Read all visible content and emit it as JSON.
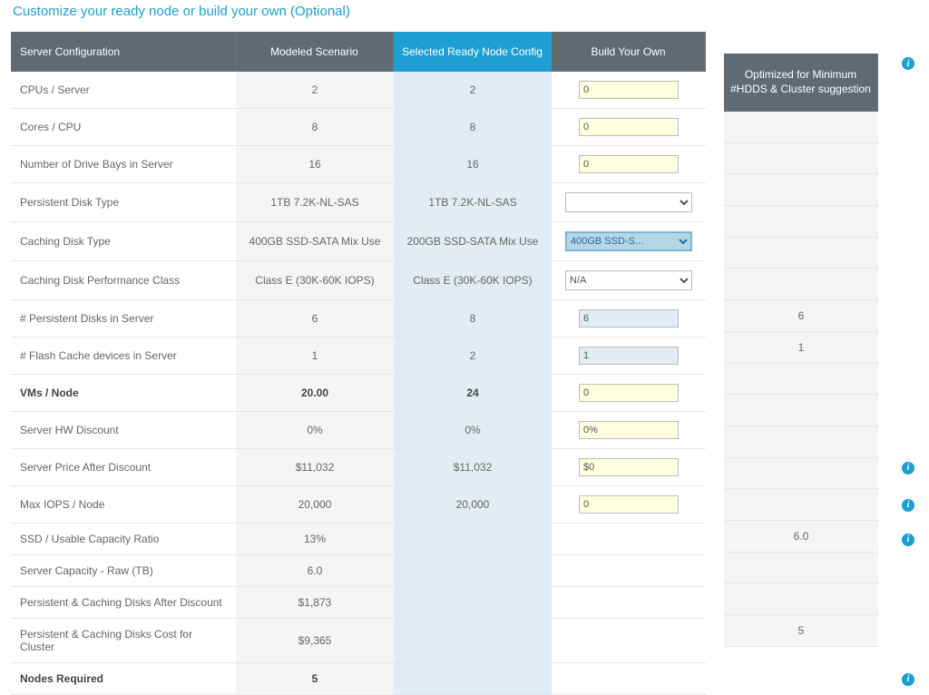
{
  "title": "Customize your ready node or build your own (Optional)",
  "headers": {
    "config": "Server Configuration",
    "modeled": "Modeled Scenario",
    "selected": "Selected Ready Node Config",
    "byo": "Build Your Own",
    "optimized": "Optimized for Minimum #HDDS & Cluster suggestion"
  },
  "rows": [
    {
      "label": "CPUs / Server",
      "model": "2",
      "sel": "2",
      "byo": "0",
      "byo_type": "text",
      "opt": ""
    },
    {
      "label": "Cores / CPU",
      "model": "8",
      "sel": "8",
      "byo": "0",
      "byo_type": "text",
      "opt": ""
    },
    {
      "label": "Number of Drive Bays in Server",
      "model": "16",
      "sel": "16",
      "byo": "0",
      "byo_type": "text",
      "opt": ""
    },
    {
      "label": "Persistent Disk Type",
      "model": "1TB 7.2K-NL-SAS",
      "sel": "1TB 7.2K-NL-SAS",
      "byo": "",
      "byo_type": "select",
      "opt": ""
    },
    {
      "label": "Caching Disk Type",
      "model": "400GB SSD-SATA Mix Use",
      "sel": "200GB SSD-SATA Mix Use",
      "byo": "400GB SSD-S...",
      "byo_type": "select_blue",
      "opt": ""
    },
    {
      "label": "Caching Disk Performance Class",
      "model": "Class E (30K-60K IOPS)",
      "sel": "Class E (30K-60K IOPS)",
      "byo": "N/A",
      "byo_type": "select",
      "opt": ""
    },
    {
      "label": "# Persistent Disks in Server",
      "model": "6",
      "sel": "8",
      "byo": "6",
      "byo_type": "readonly",
      "opt": "6"
    },
    {
      "label": "# Flash Cache devices in Server",
      "model": "1",
      "sel": "2",
      "byo": "1",
      "byo_type": "readonly",
      "opt": "1"
    },
    {
      "label": "VMs / Node",
      "model": "20.00",
      "sel": "24",
      "byo": "0",
      "byo_type": "text",
      "opt": "",
      "bold": true
    },
    {
      "label": "Server HW Discount",
      "model": "0%",
      "sel": "0%",
      "byo": "0%",
      "byo_type": "text",
      "opt": ""
    },
    {
      "label": "Server Price After Discount",
      "model": "$11,032",
      "sel": "$11,032",
      "byo": "$0",
      "byo_type": "text",
      "opt": "",
      "info": true
    },
    {
      "label": "Max IOPS / Node",
      "model": "20,000",
      "sel": "20,000",
      "byo": "0",
      "byo_type": "text",
      "opt": "",
      "info": true
    },
    {
      "label": "SSD / Usable Capacity Ratio",
      "model": "13%",
      "sel": "",
      "byo": "",
      "byo_type": "none",
      "opt": "",
      "info": true
    },
    {
      "label": "Server Capacity - Raw (TB)",
      "model": "6.0",
      "sel": "",
      "byo": "",
      "byo_type": "none",
      "opt": "6.0"
    },
    {
      "label": "Persistent & Caching Disks After Discount",
      "model": "$1,873",
      "sel": "",
      "byo": "",
      "byo_type": "none",
      "opt": ""
    },
    {
      "label": "Persistent & Caching Disks Cost for Cluster",
      "model": "$9,365",
      "sel": "",
      "byo": "",
      "byo_type": "none",
      "opt": ""
    },
    {
      "label": "Nodes Required",
      "model": "5",
      "sel": "",
      "byo": "",
      "byo_type": "none",
      "opt": "5",
      "bold": true,
      "info": true
    }
  ]
}
